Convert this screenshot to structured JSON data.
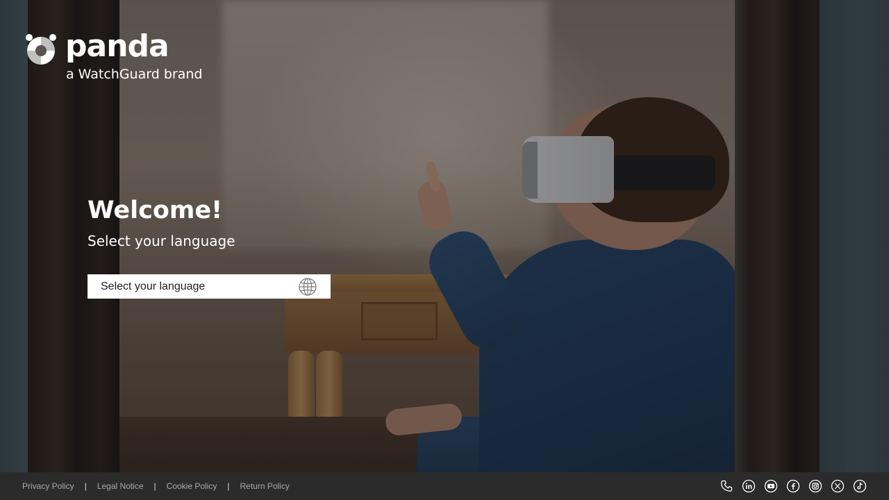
{
  "brand": {
    "wordmark": "panda",
    "tagline": "a WatchGuard brand"
  },
  "welcome": {
    "title": "Welcome!",
    "subtitle": "Select your language"
  },
  "language_select": {
    "placeholder": "Select your language",
    "icon": "globe-icon"
  },
  "footer": {
    "links": [
      {
        "label": "Privacy Policy"
      },
      {
        "label": "Legal Notice"
      },
      {
        "label": "Cookie Policy"
      },
      {
        "label": "Return Policy"
      }
    ],
    "separator": "|",
    "socials": [
      {
        "icon": "phone-icon"
      },
      {
        "icon": "linkedin-icon"
      },
      {
        "icon": "youtube-icon"
      },
      {
        "icon": "facebook-icon"
      },
      {
        "icon": "instagram-icon"
      },
      {
        "icon": "x-twitter-icon"
      },
      {
        "icon": "tiktok-icon"
      }
    ]
  },
  "colors": {
    "footer_bg": "#2b2b2b",
    "footer_text": "#a9a9a9",
    "text_on_hero": "#ffffff",
    "select_bg": "#ffffff"
  }
}
